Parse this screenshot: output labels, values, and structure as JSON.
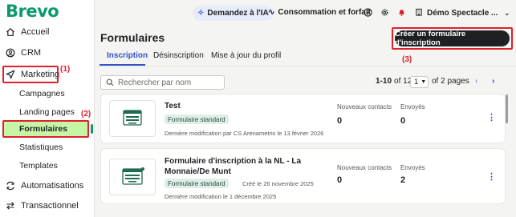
{
  "app": {
    "logo": "Brevo"
  },
  "sidebar": {
    "items": [
      {
        "label": "Accueil",
        "icon": "home-icon"
      },
      {
        "label": "CRM",
        "icon": "contacts-icon"
      },
      {
        "label": "Marketing",
        "icon": "send-icon"
      },
      {
        "label": "Automatisations",
        "icon": "automation-icon"
      },
      {
        "label": "Transactionnel",
        "icon": "transfer-icon"
      }
    ],
    "sub_items": [
      "Campagnes",
      "Landing pages",
      "Formulaires",
      "Statistiques",
      "Templates"
    ],
    "active_sub": "Formulaires"
  },
  "annotations": {
    "a1": "(1)",
    "a2": "(2)",
    "a3": "(3)"
  },
  "topbar": {
    "ai_label": "Demandez à l'IA",
    "consumption_label": "Consommation et forfait",
    "account_label": "Démo Spectacle ...",
    "icons": [
      "help-icon",
      "settings-icon",
      "bell-icon",
      "building-icon"
    ]
  },
  "page": {
    "title": "Formulaires",
    "create_label": "Créer un formulaire d'inscription"
  },
  "tabs": [
    "Inscription",
    "Désinscription",
    "Mise à jour du profil"
  ],
  "search": {
    "placeholder": "Rechercher par nom"
  },
  "pagination": {
    "range": "1-10",
    "of": "of 12",
    "page": "1",
    "total": "of 2 pages"
  },
  "forms": [
    {
      "title": "Test",
      "tag": "Formulaire standard",
      "created": "",
      "modified": "Dernière modification par CS Arenametrix le 13 février 2026",
      "new_contacts_label": "Nouveaux contacts",
      "new_contacts": "0",
      "sent_label": "Envoyés",
      "sent": "0"
    },
    {
      "title": "Formulaire d'inscription à la NL - La Monnaie/De Munt",
      "tag": "Formulaire standard",
      "created": "Créé le 26 novembre 2025",
      "modified": "Dernière modification le 1 décembre 2025",
      "new_contacts_label": "Nouveaux contacts",
      "new_contacts": "0",
      "sent_label": "Envoyés",
      "sent": "2"
    }
  ],
  "colors": {
    "brand": "#0b996e",
    "accent": "#3551c9",
    "highlight": "#c6f5a6",
    "annotation": "#e0202a"
  }
}
